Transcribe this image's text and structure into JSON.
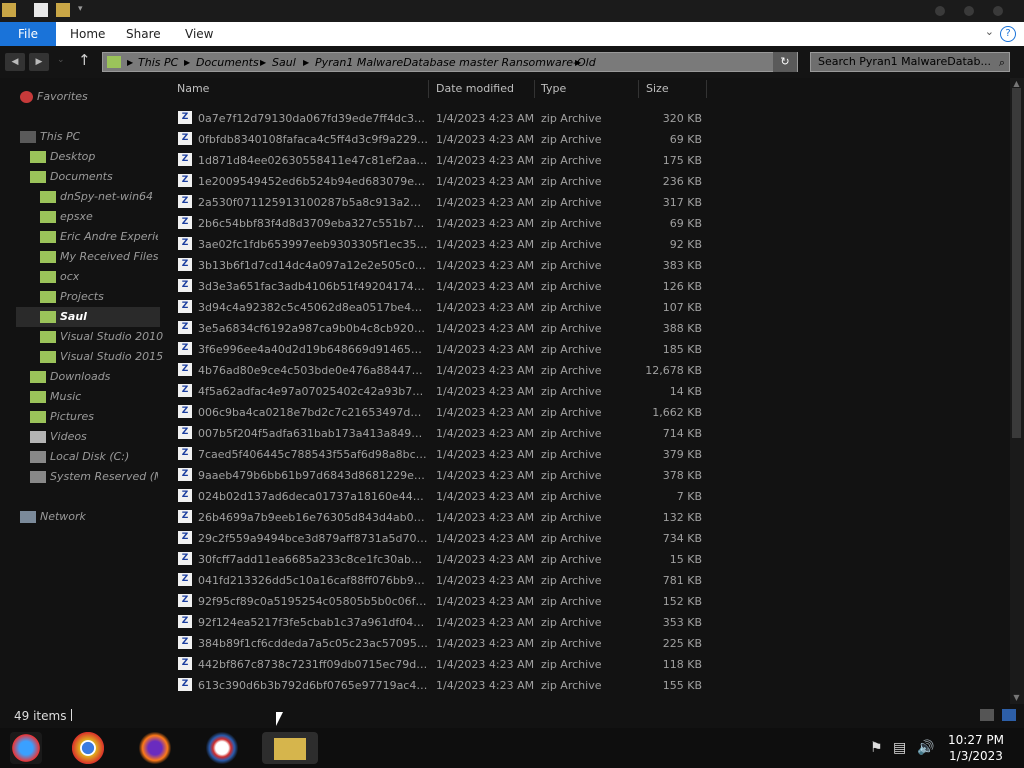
{
  "titlebar": {
    "icons": [
      "explorer-folder-icon",
      "properties-icon",
      "new-folder-icon",
      "customize-qat-icon"
    ]
  },
  "ribbon": {
    "tabs": [
      "File",
      "Home",
      "Share",
      "View"
    ],
    "help": "?"
  },
  "address": {
    "crumbs": [
      "This PC",
      "Documents",
      "Saul",
      "Pyran1 MalwareDatabase master Ransomware-Old"
    ],
    "search_placeholder": "Search Pyran1 MalwareDatab..."
  },
  "nav": {
    "items": [
      {
        "label": "Favorites",
        "icon": "favorites-star-icon"
      },
      {
        "label": "This PC",
        "icon": "computer-icon"
      },
      {
        "label": "Desktop",
        "icon": "desktop-icon"
      },
      {
        "label": "Documents",
        "icon": "documents-icon"
      },
      {
        "label": "dnSpy-net-win64",
        "icon": "folder-icon"
      },
      {
        "label": "epsxe",
        "icon": "folder-icon"
      },
      {
        "label": "Eric Andre Experien",
        "icon": "folder-icon"
      },
      {
        "label": "My Received Files",
        "icon": "folder-icon"
      },
      {
        "label": "ocx",
        "icon": "folder-icon"
      },
      {
        "label": "Projects",
        "icon": "folder-icon"
      },
      {
        "label": "Saul",
        "icon": "folder-icon"
      },
      {
        "label": "Visual Studio 2010",
        "icon": "folder-icon"
      },
      {
        "label": "Visual Studio 2015",
        "icon": "folder-icon"
      },
      {
        "label": "Downloads",
        "icon": "downloads-icon"
      },
      {
        "label": "Music",
        "icon": "music-icon"
      },
      {
        "label": "Pictures",
        "icon": "pictures-icon"
      },
      {
        "label": "Videos",
        "icon": "videos-icon"
      },
      {
        "label": "Local Disk (C:)",
        "icon": "local-disk-icon"
      },
      {
        "label": "System Reserved (M:",
        "icon": "system-drive-icon"
      },
      {
        "label": "Network",
        "icon": "network-icon"
      }
    ]
  },
  "columns": {
    "name": "Name",
    "date": "Date modified",
    "type": "Type",
    "size": "Size"
  },
  "files": [
    {
      "name": "0a7e7f12d79130da067fd39ede7ff4dc3dc...",
      "date": "1/4/2023 4:23 AM",
      "type": "zip Archive",
      "size": "320 KB"
    },
    {
      "name": "0fbfdb8340108fafaca4c5ff4d3c9f9a2296e...",
      "date": "1/4/2023 4:23 AM",
      "type": "zip Archive",
      "size": "69 KB"
    },
    {
      "name": "1d871d84ee02630558411e47c81ef2aa8b...",
      "date": "1/4/2023 4:23 AM",
      "type": "zip Archive",
      "size": "175 KB"
    },
    {
      "name": "1e2009549452ed6b524b94ed683079ee60...",
      "date": "1/4/2023 4:23 AM",
      "type": "zip Archive",
      "size": "236 KB"
    },
    {
      "name": "2a530f071125913100287b5a8c913a26e91...",
      "date": "1/4/2023 4:23 AM",
      "type": "zip Archive",
      "size": "317 KB"
    },
    {
      "name": "2b6c54bbf83f4d8d3709eba327c551b7717...",
      "date": "1/4/2023 4:23 AM",
      "type": "zip Archive",
      "size": "69 KB"
    },
    {
      "name": "3ae02fc1fdb653997eeb9303305f1ec35db...",
      "date": "1/4/2023 4:23 AM",
      "type": "zip Archive",
      "size": "92 KB"
    },
    {
      "name": "3b13b6f1d7cd14dc4a097a12e2e505c0a4c...",
      "date": "1/4/2023 4:23 AM",
      "type": "zip Archive",
      "size": "383 KB"
    },
    {
      "name": "3d3e3a651fac3adb4106b51f49204174ae96...",
      "date": "1/4/2023 4:23 AM",
      "type": "zip Archive",
      "size": "126 KB"
    },
    {
      "name": "3d94c4a92382c5c45062d8ea0517be4011b...",
      "date": "1/4/2023 4:23 AM",
      "type": "zip Archive",
      "size": "107 KB"
    },
    {
      "name": "3e5a6834cf6192a987ca9b0b4c8cb920266...",
      "date": "1/4/2023 4:23 AM",
      "type": "zip Archive",
      "size": "388 KB"
    },
    {
      "name": "3f6e996ee4a40d2d19b648669d91465626...",
      "date": "1/4/2023 4:23 AM",
      "type": "zip Archive",
      "size": "185 KB"
    },
    {
      "name": "4b76ad80e9ce4c503bde0e476a88447426...",
      "date": "1/4/2023 4:23 AM",
      "type": "zip Archive",
      "size": "12,678 KB"
    },
    {
      "name": "4f5a62adfac4e97a07025402c42a93b7bf6...",
      "date": "1/4/2023 4:23 AM",
      "type": "zip Archive",
      "size": "14 KB"
    },
    {
      "name": "006c9ba4ca0218e7bd2c7c21653497d3215...",
      "date": "1/4/2023 4:23 AM",
      "type": "zip Archive",
      "size": "1,662 KB"
    },
    {
      "name": "007b5f204f5adfa631bab173a413a849da6...",
      "date": "1/4/2023 4:23 AM",
      "type": "zip Archive",
      "size": "714 KB"
    },
    {
      "name": "7caed5f406445c788543f55af6d98a8bc4f0...",
      "date": "1/4/2023 4:23 AM",
      "type": "zip Archive",
      "size": "379 KB"
    },
    {
      "name": "9aaeb479b6bb61b97d6843d8681229ec18...",
      "date": "1/4/2023 4:23 AM",
      "type": "zip Archive",
      "size": "378 KB"
    },
    {
      "name": "024b02d137ad6deca01737a18160e4406d...",
      "date": "1/4/2023 4:23 AM",
      "type": "zip Archive",
      "size": "7 KB"
    },
    {
      "name": "26b4699a7b9eeb16e76305d843d4ab05e...",
      "date": "1/4/2023 4:23 AM",
      "type": "zip Archive",
      "size": "132 KB"
    },
    {
      "name": "29c2f559a9494bce3d879aff8731a5d70a37...",
      "date": "1/4/2023 4:23 AM",
      "type": "zip Archive",
      "size": "734 KB"
    },
    {
      "name": "30fcff7add11ea6685a233c8ce1fc30abe67...",
      "date": "1/4/2023 4:23 AM",
      "type": "zip Archive",
      "size": "15 KB"
    },
    {
      "name": "041fd213326dd5c10a16caf88ff076bb98c6...",
      "date": "1/4/2023 4:23 AM",
      "type": "zip Archive",
      "size": "781 KB"
    },
    {
      "name": "92f95cf89c0a5195254c05805b5b0c06f3c7b...",
      "date": "1/4/2023 4:23 AM",
      "type": "zip Archive",
      "size": "152 KB"
    },
    {
      "name": "92f124ea5217f3fe5cbab1c37a961df0437d...",
      "date": "1/4/2023 4:23 AM",
      "type": "zip Archive",
      "size": "353 KB"
    },
    {
      "name": "384b89f1cf6cddeda7a5c05c23ac5709588...",
      "date": "1/4/2023 4:23 AM",
      "type": "zip Archive",
      "size": "225 KB"
    },
    {
      "name": "442bf867c8738c7231ff09db0715ec79d0ae...",
      "date": "1/4/2023 4:23 AM",
      "type": "zip Archive",
      "size": "118 KB"
    },
    {
      "name": "613c390d6b3b792d6bf0765e97719ac4278...",
      "date": "1/4/2023 4:23 AM",
      "type": "zip Archive",
      "size": "155 KB"
    }
  ],
  "status": {
    "count": "49 items"
  },
  "taskbar": {
    "apps": [
      "start-orb-icon",
      "chrome-icon",
      "firefox-icon",
      "obama-logo-icon",
      "file-explorer-icon"
    ],
    "clock_time": "10:27 PM",
    "clock_date": "1/3/2023"
  },
  "colors": {
    "file_tab": "#1a73d9",
    "folder": "#9bc35a",
    "background": "#121212"
  }
}
